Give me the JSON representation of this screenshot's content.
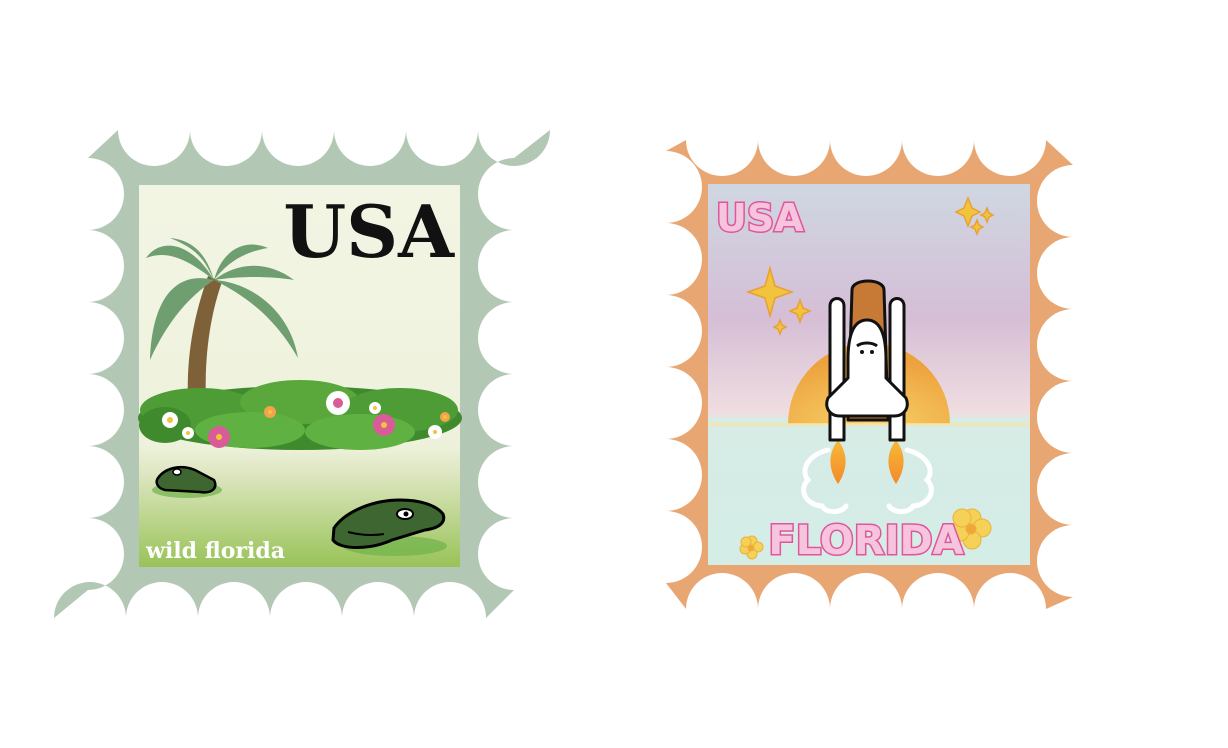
{
  "stamps": [
    {
      "country": "USA",
      "caption": "wild florida",
      "colors": {
        "frame": "#b2c8b5",
        "background_top": "#f2f5e3",
        "background_bottom": "#98c357",
        "palm": "#6f9e71",
        "trunk": "#7f6139",
        "foliage": "#3e8a2c",
        "gator": "#3d6630"
      }
    },
    {
      "country": "USA",
      "caption": "FLORIDA",
      "colors": {
        "frame": "#e8a673",
        "text": "#e0559b",
        "sky_top": "#cfd6e0",
        "sky_mid": "#d6bcd6",
        "sea": "#d3ece6",
        "sun": "#f2b44a",
        "sparkle": "#f2c43d"
      }
    }
  ]
}
